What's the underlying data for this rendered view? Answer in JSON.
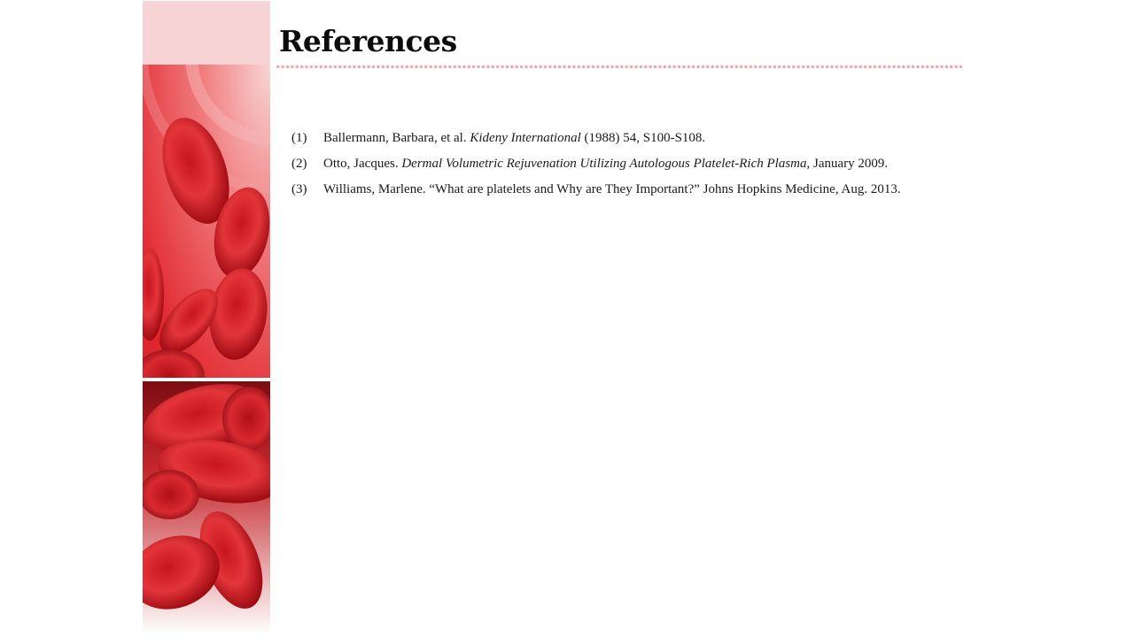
{
  "slide": {
    "title": "References"
  },
  "references": [
    {
      "number": "(1)",
      "lead": "Ballermann, Barbara, et al.",
      "italic": "Kideny International",
      "tail": "(1988) 54, S100-S108."
    },
    {
      "number": "(2)",
      "lead": "Otto, Jacques.",
      "italic": "Dermal Volumetric Rejuvenation Utilizing Autologous Platelet-Rich Plasma",
      "tail": ", January 2009."
    },
    {
      "number": "(3)",
      "lead": "Williams, Marlene. “What are platelets and Why are They Important?” Johns Hopkins Medicine, Aug. 2013.",
      "italic": "",
      "tail": ""
    }
  ],
  "decoration": {
    "image": "red-blood-cells-image",
    "accent_color": "#f8d3d3",
    "dot_color": "#f0a9ab",
    "cell_color": "#d8232a"
  }
}
